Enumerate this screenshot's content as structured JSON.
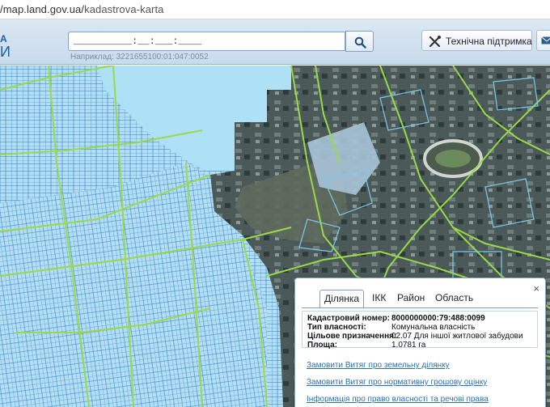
{
  "browser": {
    "url_prefix": "/map.land.gov.ua/",
    "url_path": "kadastrova-karta"
  },
  "header": {
    "logo_top": "А",
    "logo_bottom": "И",
    "search_value": "__________:__:___:____",
    "search_hint": "Наприклад: 3221655100:01:047:0052",
    "support_label": "Технічна підтримка",
    "search_icon": "search-icon",
    "support_icon": "tools-icon",
    "mail_icon": "mail-icon"
  },
  "popup": {
    "close_label": "×",
    "tabs": [
      "Ділянка",
      "ІКК",
      "Район",
      "Область"
    ],
    "active_tab": "Ділянка",
    "fields": [
      {
        "key": "Кадастровий номер:",
        "value": "8000000000:79:488:0099"
      },
      {
        "key": "Тип власності:",
        "value": "Комунальна власність"
      },
      {
        "key": "Цільове призначення:",
        "value": "02.07 Для іншої житлової забудови"
      },
      {
        "key": "Площа:",
        "value": "1.0781 га"
      }
    ],
    "links": [
      "Замовити Витяг про земельну ділянку",
      "Замовити Витяг про нормативну грошову оцінку",
      "Інформація про право власності та речові права"
    ]
  },
  "colors": {
    "accent": "#2a6fb5",
    "parcel_fill": "#a9d7f0",
    "parcel_line": "#2d7fc1",
    "boundary_line": "#9ad94a"
  }
}
